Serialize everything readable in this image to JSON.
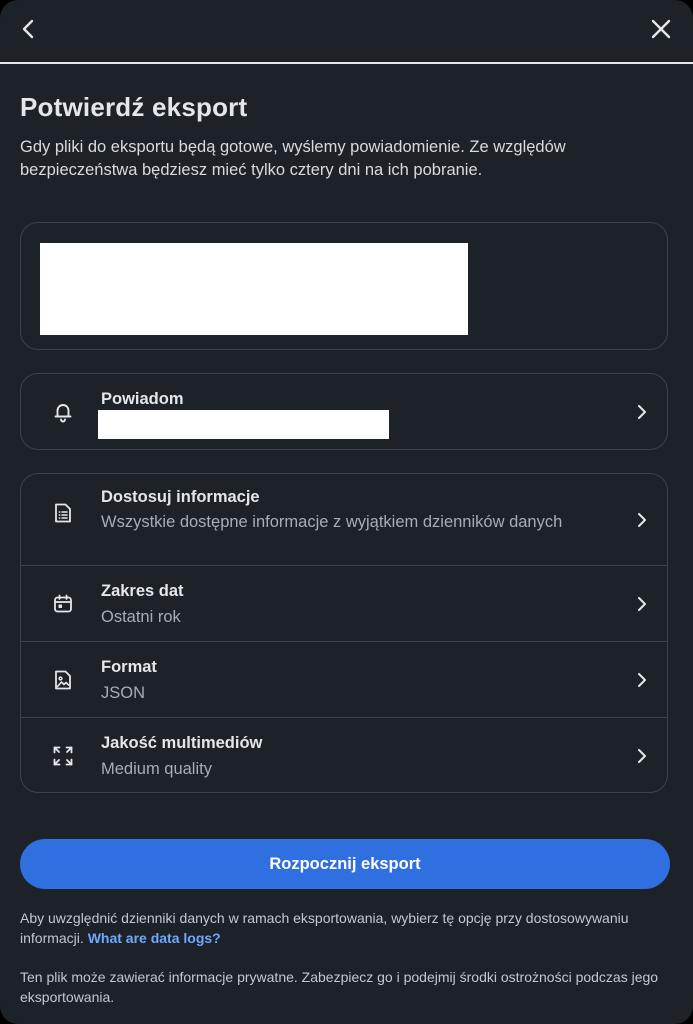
{
  "header": {
    "back_icon": "chevron-left-icon",
    "close_icon": "close-icon"
  },
  "page": {
    "title": "Potwierdź eksport",
    "subtitle": "Gdy pliki do eksportu będą gotowe, wyślemy powiadomienie. Ze względów bezpieczeństwa będziesz mieć tylko cztery dni na ich pobranie."
  },
  "notify": {
    "icon": "bell-icon",
    "title": "Powiadom"
  },
  "options": [
    {
      "icon": "document-list-icon",
      "title": "Dostosuj informacje",
      "subtitle": "Wszystkie dostępne informacje z wyjątkiem dzienników danych"
    },
    {
      "icon": "calendar-icon",
      "title": "Zakres dat",
      "subtitle": "Ostatni rok"
    },
    {
      "icon": "image-file-icon",
      "title": "Format",
      "subtitle": "JSON"
    },
    {
      "icon": "expand-arrows-icon",
      "title": "Jakość multimediów",
      "subtitle": "Medium quality"
    }
  ],
  "actions": {
    "start_export": "Rozpocznij eksport"
  },
  "footer": {
    "note1_text": "Aby uwzględnić dzienniki danych w ramach eksportowania, wybierz tę opcję przy dostosowywaniu informacji.",
    "note1_link": "What are data logs?",
    "note2": "Ten plik może zawierać informacje prywatne. Zabezpiecz go i podejmij środki ostrożności podczas jego eksportowania."
  },
  "colors": {
    "background": "#1c2228",
    "primary_button": "#2f6fe0",
    "link": "#6ea8ff",
    "border": "#3a434c"
  }
}
